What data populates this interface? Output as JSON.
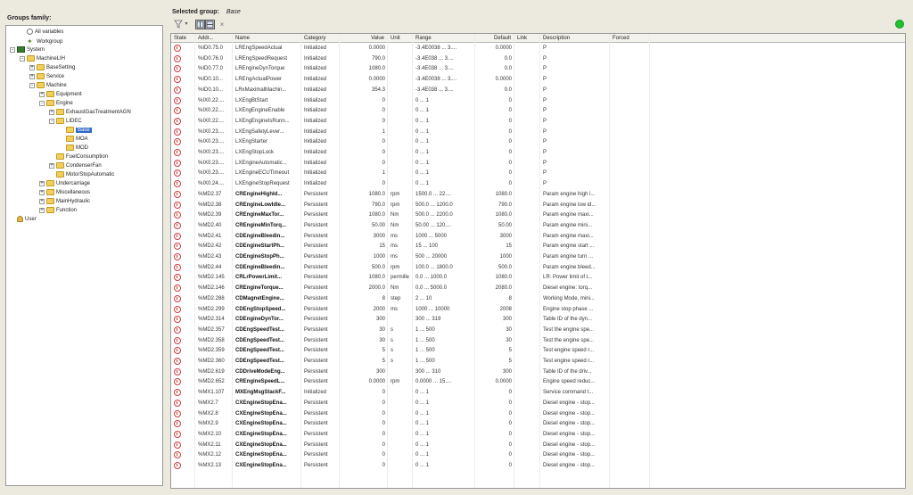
{
  "left": {
    "title": "Groups family:",
    "tree": [
      {
        "label": "All variables",
        "icon": "radio-icon",
        "level": 1,
        "expander": ""
      },
      {
        "label": "Workgroup",
        "icon": "star-icon",
        "level": 1,
        "expander": ""
      },
      {
        "label": "System",
        "icon": "system-icon",
        "level": 0,
        "expander": "-"
      },
      {
        "label": "MachineLIH",
        "icon": "folder-icon",
        "level": 1,
        "expander": "-"
      },
      {
        "label": "BaseSetting",
        "icon": "folder-icon",
        "level": 2,
        "expander": "+"
      },
      {
        "label": "Service",
        "icon": "folder-icon",
        "level": 2,
        "expander": "+"
      },
      {
        "label": "Machine",
        "icon": "folder-icon",
        "level": 2,
        "expander": "-"
      },
      {
        "label": "Equipment",
        "icon": "folder-icon",
        "level": 3,
        "expander": "+"
      },
      {
        "label": "Engine",
        "icon": "folder-icon",
        "level": 3,
        "expander": "-"
      },
      {
        "label": "ExhaustGasTreatmentAGN",
        "icon": "folder-icon",
        "level": 4,
        "expander": "+"
      },
      {
        "label": "LIDEC",
        "icon": "folder-icon",
        "level": 4,
        "expander": "-"
      },
      {
        "label": "Base",
        "icon": "folder-icon",
        "level": 5,
        "expander": "",
        "selected": true
      },
      {
        "label": "MOA",
        "icon": "folder-icon",
        "level": 5,
        "expander": ""
      },
      {
        "label": "MOD",
        "icon": "folder-icon",
        "level": 5,
        "expander": ""
      },
      {
        "label": "FuelConsumption",
        "icon": "folder-icon",
        "level": 4,
        "expander": ""
      },
      {
        "label": "CondenserFan",
        "icon": "folder-icon",
        "level": 4,
        "expander": "+"
      },
      {
        "label": "MotorStopAutomatic",
        "icon": "folder-icon",
        "level": 4,
        "expander": ""
      },
      {
        "label": "Undercarriage",
        "icon": "folder-icon",
        "level": 3,
        "expander": "+"
      },
      {
        "label": "Miscellaneous",
        "icon": "folder-icon",
        "level": 3,
        "expander": "+"
      },
      {
        "label": "MainHydraulic",
        "icon": "folder-icon",
        "level": 3,
        "expander": "+"
      },
      {
        "label": "Function",
        "icon": "folder-icon",
        "level": 3,
        "expander": "+"
      },
      {
        "label": "User",
        "icon": "user-icon",
        "level": 0,
        "expander": ""
      }
    ]
  },
  "header": {
    "selected_group_label": "Selected group:",
    "selected_group_value": "Base"
  },
  "toolbar": {
    "filter_icon": "filter-icon",
    "view_icon": "columns-view-icon",
    "close_icon": "close-icon",
    "close_glyph": "×"
  },
  "status_color": "#21c22f",
  "columns": [
    "State",
    "Addr...",
    "Name",
    "Category",
    "Value",
    "Unit",
    "Range",
    "Default",
    "Link",
    "Description",
    "Forced"
  ],
  "rows": [
    [
      "%ID0.75.0",
      "LREngSpeedActual",
      "Initialized",
      "0.0000",
      "",
      "-3.4E0038 ... 3....",
      "0.0000",
      "",
      "P",
      "",
      false
    ],
    [
      "%ID0.76.0",
      "LREngSpeedRequest",
      "Initialized",
      "790.0",
      "",
      "-3.4E038 ... 3....",
      "0.0",
      "",
      "P",
      "",
      false
    ],
    [
      "%ID0.77.0",
      "LREngineDynTorque",
      "Initialized",
      "1080.0",
      "",
      "-3.4E038 ... 3....",
      "0.0",
      "",
      "P",
      "",
      false
    ],
    [
      "%ID0.10...",
      "LREngActualPower",
      "Initialized",
      "0.0000",
      "",
      "-3.4E0038 ... 3....",
      "0.0000",
      "",
      "P",
      "",
      false
    ],
    [
      "%ID0.10...",
      "LRxMaximalMachin...",
      "Initialized",
      "354.3",
      "",
      "-3.4E038 ... 3....",
      "0.0",
      "",
      "P",
      "",
      false
    ],
    [
      "%IX0.22....",
      "LXEngBtStart",
      "Initialized",
      "0",
      "",
      "0 ... 1",
      "0",
      "",
      "P",
      "",
      false
    ],
    [
      "%IX0.22....",
      "LXEngEngineEnable",
      "Initialized",
      "0",
      "",
      "0 ... 1",
      "0",
      "",
      "P",
      "",
      false
    ],
    [
      "%IX0.22....",
      "LXEngEngineIsRunn...",
      "Initialized",
      "0",
      "",
      "0 ... 1",
      "0",
      "",
      "P",
      "",
      false
    ],
    [
      "%IX0.23....",
      "LXEngSafetyLever...",
      "Initialized",
      "1",
      "",
      "0 ... 1",
      "0",
      "",
      "P",
      "",
      false
    ],
    [
      "%IX0.23....",
      "LXEngStarter",
      "Initialized",
      "0",
      "",
      "0 ... 1",
      "0",
      "",
      "P",
      "",
      false
    ],
    [
      "%IX0.23....",
      "LXEngStopLock",
      "Initialized",
      "0",
      "",
      "0 ... 1",
      "0",
      "",
      "P",
      "",
      false
    ],
    [
      "%IX0.23....",
      "LXEngineAutomatic...",
      "Initialized",
      "0",
      "",
      "0 ... 1",
      "0",
      "",
      "P",
      "",
      false
    ],
    [
      "%IX0.23....",
      "LXEngineECUTimeout",
      "Initialized",
      "1",
      "",
      "0 ... 1",
      "0",
      "",
      "P",
      "",
      false
    ],
    [
      "%IX0.24....",
      "LXEngineStopRequest",
      "Initialized",
      "0",
      "",
      "0 ... 1",
      "0",
      "",
      "P",
      "",
      false
    ],
    [
      "%MD2.37",
      "CREngineHighId...",
      "Persistent",
      "1080.0",
      "rpm",
      "1500.0 ... 22....",
      "1080.0",
      "",
      "Param engine high i...",
      "",
      true
    ],
    [
      "%MD2.38",
      "CREngineLowIdle...",
      "Persistent",
      "790.0",
      "rpm",
      "500.0 ... 1200.0",
      "790.0",
      "",
      "Param engine low id...",
      "",
      true
    ],
    [
      "%MD2.39",
      "CREngineMaxTor...",
      "Persistent",
      "1080.0",
      "Nm",
      "500.0 ... 2200.0",
      "1080.0",
      "",
      "Param engine maxi...",
      "",
      true
    ],
    [
      "%MD2.40",
      "CREngineMinTorq...",
      "Persistent",
      "50.00",
      "Nm",
      "50.00 ... 120....",
      "50.00",
      "",
      "Param engine mini...",
      "",
      true
    ],
    [
      "%MD2.41",
      "CDEngineBleedin...",
      "Persistent",
      "3000",
      "ms",
      "1000 ... 5000",
      "3000",
      "",
      "Param engine maxi...",
      "",
      true
    ],
    [
      "%MD2.42",
      "CDEngineStartPh...",
      "Persistent",
      "15",
      "ms",
      "15 ... 100",
      "15",
      "",
      "Param engine start ...",
      "",
      true
    ],
    [
      "%MD2.43",
      "CDEngineStopPh...",
      "Persistent",
      "1000",
      "ms",
      "500 ... 20000",
      "1000",
      "",
      "Param engine turn ...",
      "",
      true
    ],
    [
      "%MD2.44",
      "CDEngineBleedin...",
      "Persistent",
      "500.0",
      "rpm",
      "100.0 ... 1800.0",
      "500.0",
      "",
      "Param engine bleed...",
      "",
      true
    ],
    [
      "%MD2.145",
      "CRLrPowerLimit...",
      "Persistent",
      "1080.0",
      "permille",
      "0.0 ... 1000.0",
      "1080.0",
      "",
      "LR: Power limit of t...",
      "",
      true
    ],
    [
      "%MD2.146",
      "CREngineTorque...",
      "Persistent",
      "2000.0",
      "Nm",
      "0.0 ... 5000.0",
      "2080.0",
      "",
      "Diesel engine: torq...",
      "",
      true
    ],
    [
      "%MD2.288",
      "CDMagnetEngine...",
      "Persistent",
      "8",
      "step",
      "2 ... 10",
      "8",
      "",
      "Working Mode, mini...",
      "",
      true
    ],
    [
      "%MD2.299",
      "CDEngStopSpeed...",
      "Persistent",
      "2000",
      "ms",
      "1000 ... 10000",
      "2008",
      "",
      "Engine stop phase ...",
      "",
      true
    ],
    [
      "%MD2.314",
      "CDEngineDynTor...",
      "Persistent",
      "300",
      "",
      "300 ... 319",
      "300",
      "",
      "Table ID of the dyn...",
      "",
      true
    ],
    [
      "%MD2.357",
      "CDEngSpeedTest...",
      "Persistent",
      "30",
      "s",
      "1 ... 500",
      "30",
      "",
      "Test the engine spe...",
      "",
      true
    ],
    [
      "%MD2.358",
      "CDEngSpeedTest...",
      "Persistent",
      "30",
      "s",
      "1 ... 500",
      "30",
      "",
      "Test the engine spe...",
      "",
      true
    ],
    [
      "%MD2.359",
      "CDEngSpeedTest...",
      "Persistent",
      "5",
      "s",
      "1 ... 500",
      "5",
      "",
      "Test engine speed r...",
      "",
      true
    ],
    [
      "%MD2.360",
      "CDEngSpeedTest...",
      "Persistent",
      "5",
      "s",
      "1 ... 500",
      "5",
      "",
      "Test engine speed r...",
      "",
      true
    ],
    [
      "%MD2.619",
      "CDDriveModeEng...",
      "Persistent",
      "300",
      "",
      "300 ... 310",
      "300",
      "",
      "Table ID of the driv...",
      "",
      true
    ],
    [
      "%MD2.652",
      "CREngineSpeedL...",
      "Persistent",
      "0.0000",
      "rpm",
      "0.0000 ... 15....",
      "0.0000",
      "",
      "Engine speed reduc...",
      "",
      true
    ],
    [
      "%MX1.107",
      "MXEngMsgStackF...",
      "Initialized",
      "0",
      "",
      "0 ... 1",
      "0",
      "",
      "Service command t...",
      "",
      true
    ],
    [
      "%MX2.7",
      "CXEngineStopEna...",
      "Persistent",
      "0",
      "",
      "0 ... 1",
      "0",
      "",
      "Diesel engine - stop...",
      "",
      true
    ],
    [
      "%MX2.8",
      "CXEngineStopEna...",
      "Persistent",
      "0",
      "",
      "0 ... 1",
      "0",
      "",
      "Diesel engine - stop...",
      "",
      true
    ],
    [
      "%MX2.9",
      "CXEngineStopEna...",
      "Persistent",
      "0",
      "",
      "0 ... 1",
      "0",
      "",
      "Diesel engine - stop...",
      "",
      true
    ],
    [
      "%MX2.10",
      "CXEngineStopEna...",
      "Persistent",
      "0",
      "",
      "0 ... 1",
      "0",
      "",
      "Diesel engine - stop...",
      "",
      true
    ],
    [
      "%MX2.11",
      "CXEngineStopEna...",
      "Persistent",
      "0",
      "",
      "0 ... 1",
      "0",
      "",
      "Diesel engine - stop...",
      "",
      true
    ],
    [
      "%MX2.12",
      "CXEngineStopEna...",
      "Persistent",
      "0",
      "",
      "0 ... 1",
      "0",
      "",
      "Diesel engine - stop...",
      "",
      true
    ],
    [
      "%MX2.13",
      "CXEngineStopEna...",
      "Persistent",
      "0",
      "",
      "0 ... 1",
      "0",
      "",
      "Diesel engine - stop...",
      "",
      true
    ]
  ]
}
